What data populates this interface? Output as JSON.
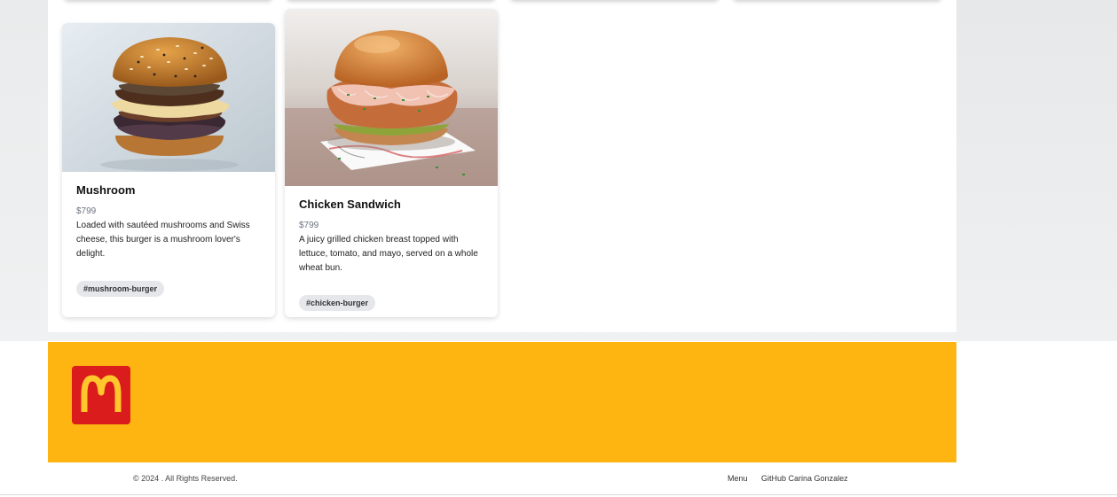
{
  "cards": [
    {
      "title": "Mushroom",
      "price": "$799",
      "description": "Loaded with sautéed mushrooms and Swiss cheese, this burger is a mushroom lover's delight.",
      "tag": "#mushroom-burger"
    },
    {
      "title": "Chicken Sandwich",
      "price": "$799",
      "description": "A juicy grilled chicken breast topped with lettuce, tomato, and mayo, served on a whole wheat bun.",
      "tag": "#chicken-burger"
    }
  ],
  "footer": {
    "copyright": "© 2024 . All Rights Reserved.",
    "links": [
      "Menu",
      "GitHub Carina Gonzalez"
    ]
  },
  "colors": {
    "footer_band": "#ffb511",
    "logo_bg": "#da1c1c",
    "logo_arches": "#ffc72c"
  },
  "icons": {
    "logo": "mcdonalds-golden-arches-logo"
  }
}
